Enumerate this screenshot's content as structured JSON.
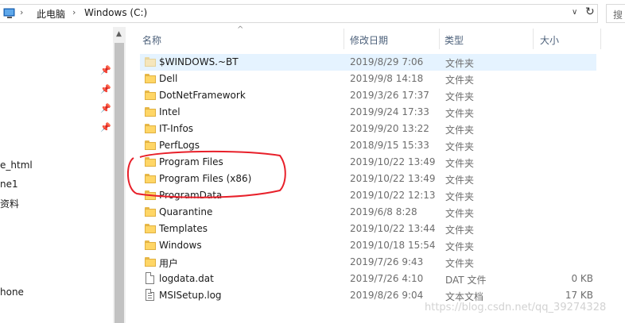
{
  "address": {
    "crumbs": [
      "此电脑",
      "Windows (C:)"
    ],
    "search_placeholder": "搜"
  },
  "nav": {
    "items": [
      "e_html",
      "ne1",
      "资料",
      "hone"
    ]
  },
  "columns": {
    "name": "名称",
    "date": "修改日期",
    "type": "类型",
    "size": "大小"
  },
  "files": [
    {
      "name": "$WINDOWS.~BT",
      "date": "2019/8/29 7:06",
      "type": "文件夹",
      "size": "",
      "icon": "folder-icon-hidden",
      "selected": true
    },
    {
      "name": "Dell",
      "date": "2019/9/8 14:18",
      "type": "文件夹",
      "size": "",
      "icon": "folder-icon"
    },
    {
      "name": "DotNetFramework",
      "date": "2019/3/26 17:37",
      "type": "文件夹",
      "size": "",
      "icon": "folder-icon"
    },
    {
      "name": "Intel",
      "date": "2019/9/24 17:33",
      "type": "文件夹",
      "size": "",
      "icon": "folder-icon"
    },
    {
      "name": "IT-Infos",
      "date": "2019/9/20 13:22",
      "type": "文件夹",
      "size": "",
      "icon": "folder-icon"
    },
    {
      "name": "PerfLogs",
      "date": "2018/9/15 15:33",
      "type": "文件夹",
      "size": "",
      "icon": "folder-icon"
    },
    {
      "name": "Program Files",
      "date": "2019/10/22 13:49",
      "type": "文件夹",
      "size": "",
      "icon": "folder-icon"
    },
    {
      "name": "Program Files (x86)",
      "date": "2019/10/22 13:49",
      "type": "文件夹",
      "size": "",
      "icon": "folder-icon"
    },
    {
      "name": "ProgramData",
      "date": "2019/10/22 12:13",
      "type": "文件夹",
      "size": "",
      "icon": "folder-icon"
    },
    {
      "name": "Quarantine",
      "date": "2019/6/8 8:28",
      "type": "文件夹",
      "size": "",
      "icon": "folder-icon"
    },
    {
      "name": "Templates",
      "date": "2019/10/22 13:44",
      "type": "文件夹",
      "size": "",
      "icon": "folder-icon"
    },
    {
      "name": "Windows",
      "date": "2019/10/18 15:54",
      "type": "文件夹",
      "size": "",
      "icon": "folder-icon"
    },
    {
      "name": "用户",
      "date": "2019/7/26 9:43",
      "type": "文件夹",
      "size": "",
      "icon": "folder-icon"
    },
    {
      "name": "logdata.dat",
      "date": "2019/7/26 4:10",
      "type": "DAT 文件",
      "size": "0 KB",
      "icon": "file-icon"
    },
    {
      "name": "MSISetup.log",
      "date": "2019/8/26 9:04",
      "type": "文本文档",
      "size": "17 KB",
      "icon": "text-file-icon"
    }
  ],
  "watermark": "https://blog.csdn.net/qq_39274328",
  "colors": {
    "selected_row": "#e5f3ff",
    "header_text": "#4c607a",
    "annotation_red": "#e8202a"
  }
}
